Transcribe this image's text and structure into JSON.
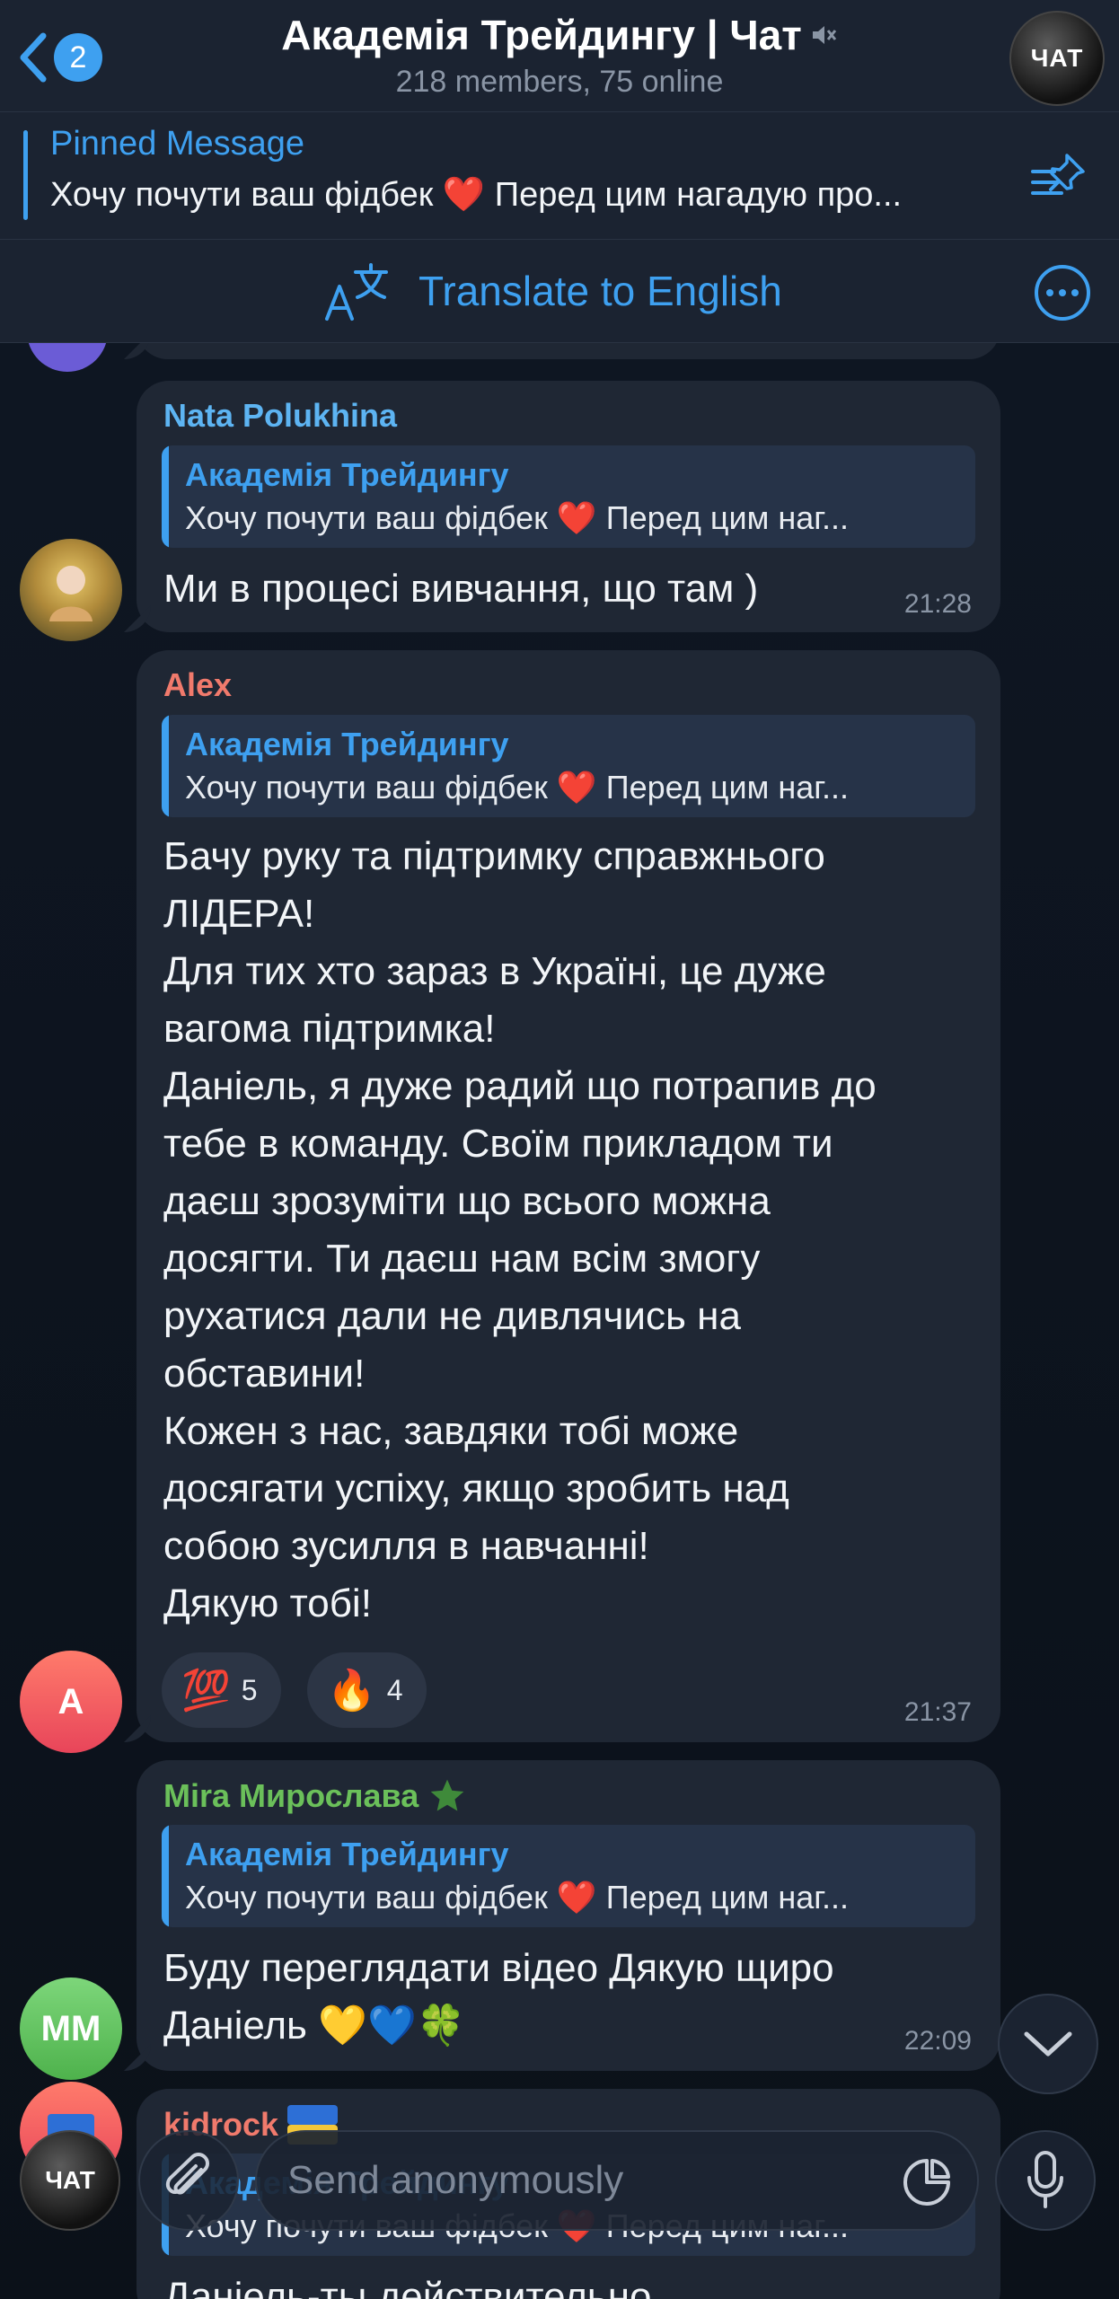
{
  "header": {
    "back_badge": "2",
    "title": "Академія Трейдингу | Чат",
    "subtitle": "218 members, 75 online",
    "avatar_text": "ЧАТ"
  },
  "pinned": {
    "title": "Pinned Message",
    "text": "Хочу почути ваш фідбек ❤️ Перед цим нагадую про..."
  },
  "translate": {
    "label": "Translate to English"
  },
  "reply_preview": {
    "name": "Академія Трейдингу",
    "text": "Хочу почути ваш фідбек ❤️ Перед цим наг..."
  },
  "messages": [
    {
      "sender": "Nata Polukhina",
      "sender_color": "#5db4f2",
      "text": "Ми в процесі вивчання, що там )",
      "time": "21:28"
    },
    {
      "sender": "Alex",
      "sender_color": "#f07a6c",
      "avatar_letter": "A",
      "text": "Бачу руку та підтримку справжнього\nЛІДЕРА!\nДля тих хто зараз в Україні, це дуже\nвагома підтримка!\nДаніель, я дуже радий що потрапив до\nтебе в команду. Своїм прикладом ти\nдаєш зрозуміти що всього можна\nдосягти. Ти даєш нам всім змогу\nрухатися дали не дивлячись на\nобставини!\nКожен з нас, завдяки тобі може\nдосягати успіху, якщо зробить над\nсобою зусилля в навчанні!\nДякую тобі!",
      "time": "21:37",
      "reactions": [
        {
          "emoji": "💯",
          "count": "5"
        },
        {
          "emoji": "🔥",
          "count": "4"
        }
      ]
    },
    {
      "sender": "Mira Мирослава",
      "sender_color": "#6bc05a",
      "avatar_letter": "MM",
      "text": "Буду переглядати відео Дякую щиро\nДаніель 💛💙🍀",
      "time": "22:09"
    },
    {
      "sender": "kidrock",
      "sender_color": "#f07a6c",
      "text": "Даніель-ты действительно"
    }
  ],
  "input": {
    "placeholder": "Send anonymously",
    "avatar_text": "ЧАТ"
  },
  "colors": {
    "accent": "#3ea0f0",
    "bubble": "#1f2734",
    "background": "#0c1320"
  }
}
